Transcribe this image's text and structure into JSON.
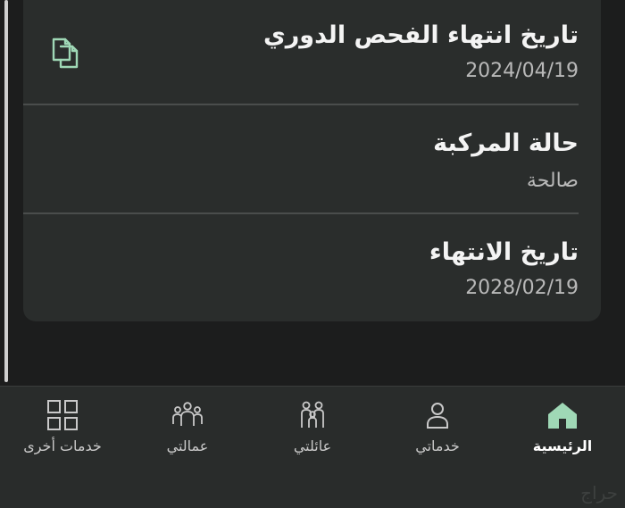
{
  "colors": {
    "accent": "#9fd8b6",
    "background": "#1c1d1d",
    "card": "#2a2d2c",
    "nav": "#292c2b"
  },
  "details": {
    "rows": [
      {
        "title": "تاريخ انتهاء الفحص الدوري",
        "value": "2024/04/19",
        "icon": "copy-icon"
      },
      {
        "title": "حالة المركبة",
        "value": "صالحة"
      },
      {
        "title": "تاريخ الانتهاء",
        "value": "2028/02/19"
      }
    ]
  },
  "bottom_nav": {
    "items": [
      {
        "label": "الرئيسية",
        "icon": "home-icon",
        "active": true
      },
      {
        "label": "خدماتي",
        "icon": "person-icon"
      },
      {
        "label": "عائلتي",
        "icon": "family-icon"
      },
      {
        "label": "عمالتي",
        "icon": "workers-icon"
      },
      {
        "label": "خدمات أخرى",
        "icon": "grid-icon"
      }
    ]
  },
  "watermark": "حراج"
}
